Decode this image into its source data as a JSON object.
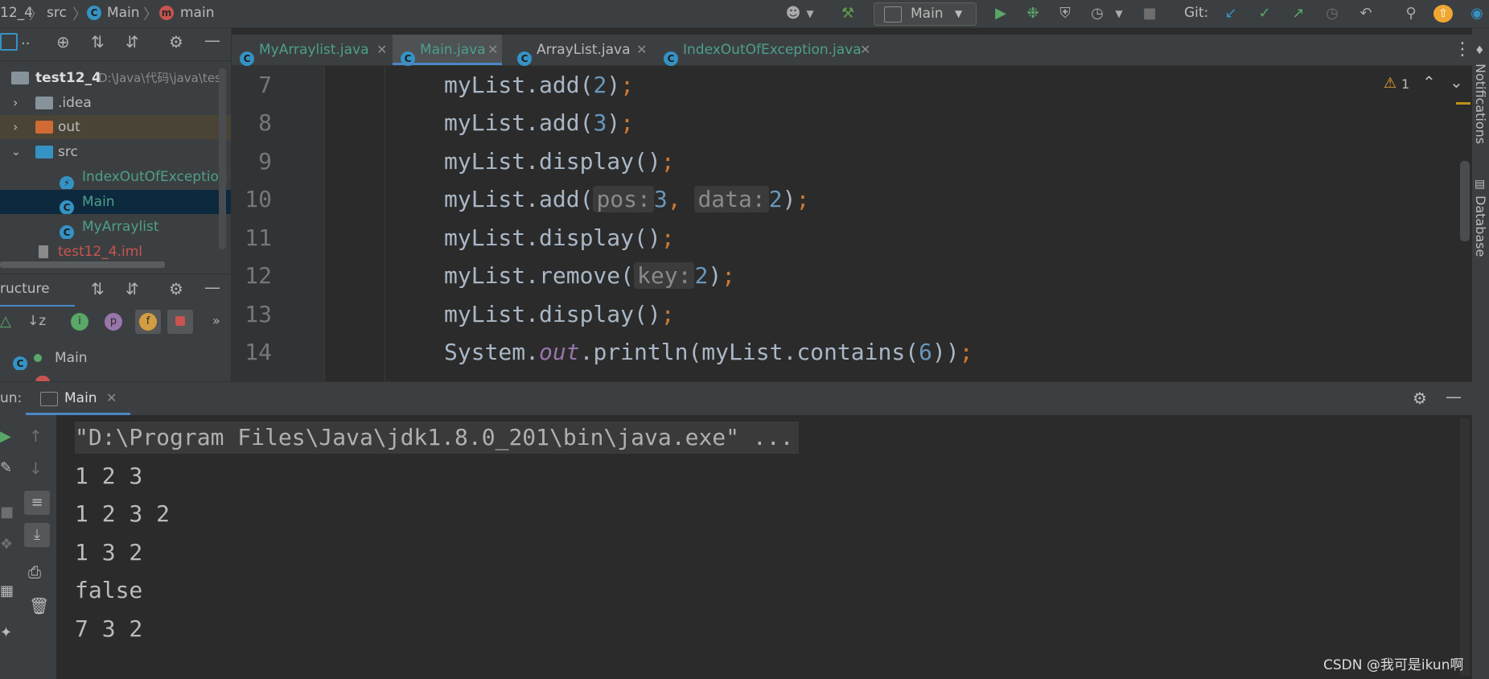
{
  "nav": {
    "project": "12_4",
    "src": "src",
    "class_crumb": "Main",
    "method_crumb": "main",
    "run_config": "Main",
    "git_label": "Git:"
  },
  "project_tree": {
    "root_name": "test12_4",
    "root_path": "D:\\Java\\代码\\java\\tes",
    "items": [
      {
        "label": "idea",
        "display": ".idea"
      },
      {
        "label": "out"
      },
      {
        "label": "src"
      },
      {
        "label": "IndexOutOfException"
      },
      {
        "label": "Main"
      },
      {
        "label": "MyArraylist"
      },
      {
        "label": "test12_4.iml"
      }
    ]
  },
  "structure": {
    "title": "ructure",
    "class_name": "Main"
  },
  "tabs": [
    {
      "label": "MyArraylist.java"
    },
    {
      "label": "Main.java"
    },
    {
      "label": "ArrayList.java"
    },
    {
      "label": "IndexOutOfException.java"
    }
  ],
  "editor": {
    "warning_count": "1",
    "lines": [
      "7",
      "8",
      "9",
      "10",
      "11",
      "12",
      "13",
      "14"
    ]
  },
  "run_panel": {
    "label": "un:",
    "tab": "Main",
    "command": "\"D:\\Program Files\\Java\\jdk1.8.0_201\\bin\\java.exe\" ...",
    "output": [
      "1 2 3",
      "1 2 3 2",
      "1 3 2",
      "false",
      "7 3 2"
    ]
  },
  "right_strip": {
    "notifications": "Notifications",
    "database": "Database"
  },
  "watermark": "CSDN @我可是ikun啊"
}
